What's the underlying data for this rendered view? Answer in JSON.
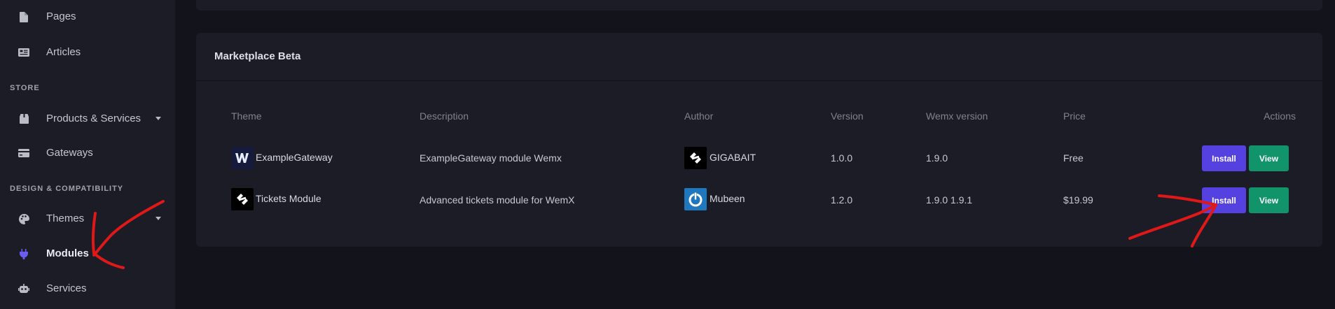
{
  "sidebar": {
    "items_top": [
      {
        "label": "Pages",
        "icon": "file-icon"
      },
      {
        "label": "Articles",
        "icon": "newspaper-icon"
      }
    ],
    "sections": [
      {
        "title": "STORE"
      },
      {
        "title": "DESIGN & COMPATIBILITY"
      }
    ],
    "store_items": [
      {
        "label": "Products & Services",
        "icon": "box-icon"
      },
      {
        "label": "Gateways",
        "icon": "credit-card-icon"
      }
    ],
    "design_items": [
      {
        "label": "Themes",
        "icon": "palette-icon"
      },
      {
        "label": "Modules",
        "icon": "plug-icon"
      },
      {
        "label": "Services",
        "icon": "robot-icon"
      }
    ]
  },
  "marketplace": {
    "title": "Marketplace Beta",
    "columns": [
      "Theme",
      "Description",
      "Author",
      "Version",
      "Wemx version",
      "Price",
      "Actions"
    ],
    "rows": [
      {
        "theme": "ExampleGateway",
        "theme_icon": "w-logo-icon",
        "description": "ExampleGateway module Wemx",
        "author": "GIGABAIT",
        "author_icon": "gigabait-logo-icon",
        "version": "1.0.0",
        "wemx_version": "1.9.0",
        "price": "Free",
        "install_label": "Install",
        "view_label": "View"
      },
      {
        "theme": "Tickets Module",
        "theme_icon": "tickets-logo-icon",
        "description": "Advanced tickets module for WemX",
        "author": "Mubeen",
        "author_icon": "power-logo-icon",
        "version": "1.2.0",
        "wemx_version": "1.9.0 1.9.1",
        "price": "$19.99",
        "install_label": "Install",
        "view_label": "View"
      }
    ]
  },
  "colors": {
    "background": "#13131c",
    "panel": "#1b1c26",
    "install": "#5441e0",
    "view": "#12946b",
    "active_icon": "#6b5cf0",
    "annotation": "#e01818"
  }
}
